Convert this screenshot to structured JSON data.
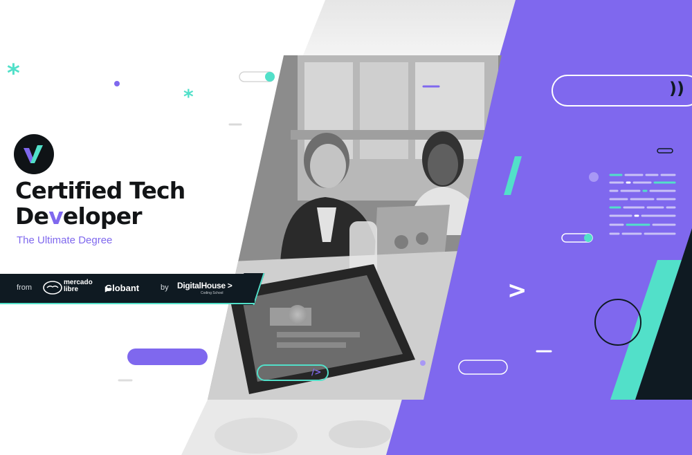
{
  "brand": {
    "title_line1": "Certified Tech",
    "title_line2_a": "De",
    "title_line2_b": "v",
    "title_line2_c": "eloper",
    "subtitle": "The Ultimate Degree"
  },
  "partners": {
    "from_label": "from",
    "mercadolibre_line1": "mercado",
    "mercadolibre_line2": "libre",
    "globant": "Globant",
    "globant_mark": "▶",
    "by_label": "by",
    "digitalhouse": "DigitalHouse >",
    "digitalhouse_sub": "Coding School"
  },
  "decor": {
    "code_tag": "/>",
    "chevron": ">",
    "wave": "))"
  },
  "colors": {
    "purple": "#7f68ee",
    "teal": "#52e0c9",
    "dark": "#0f1a22",
    "white": "#ffffff"
  },
  "icons": [
    "checkmark-logo-icon",
    "asterisk-icon",
    "chevron-right-icon",
    "code-tag-icon",
    "laptop-photo"
  ]
}
